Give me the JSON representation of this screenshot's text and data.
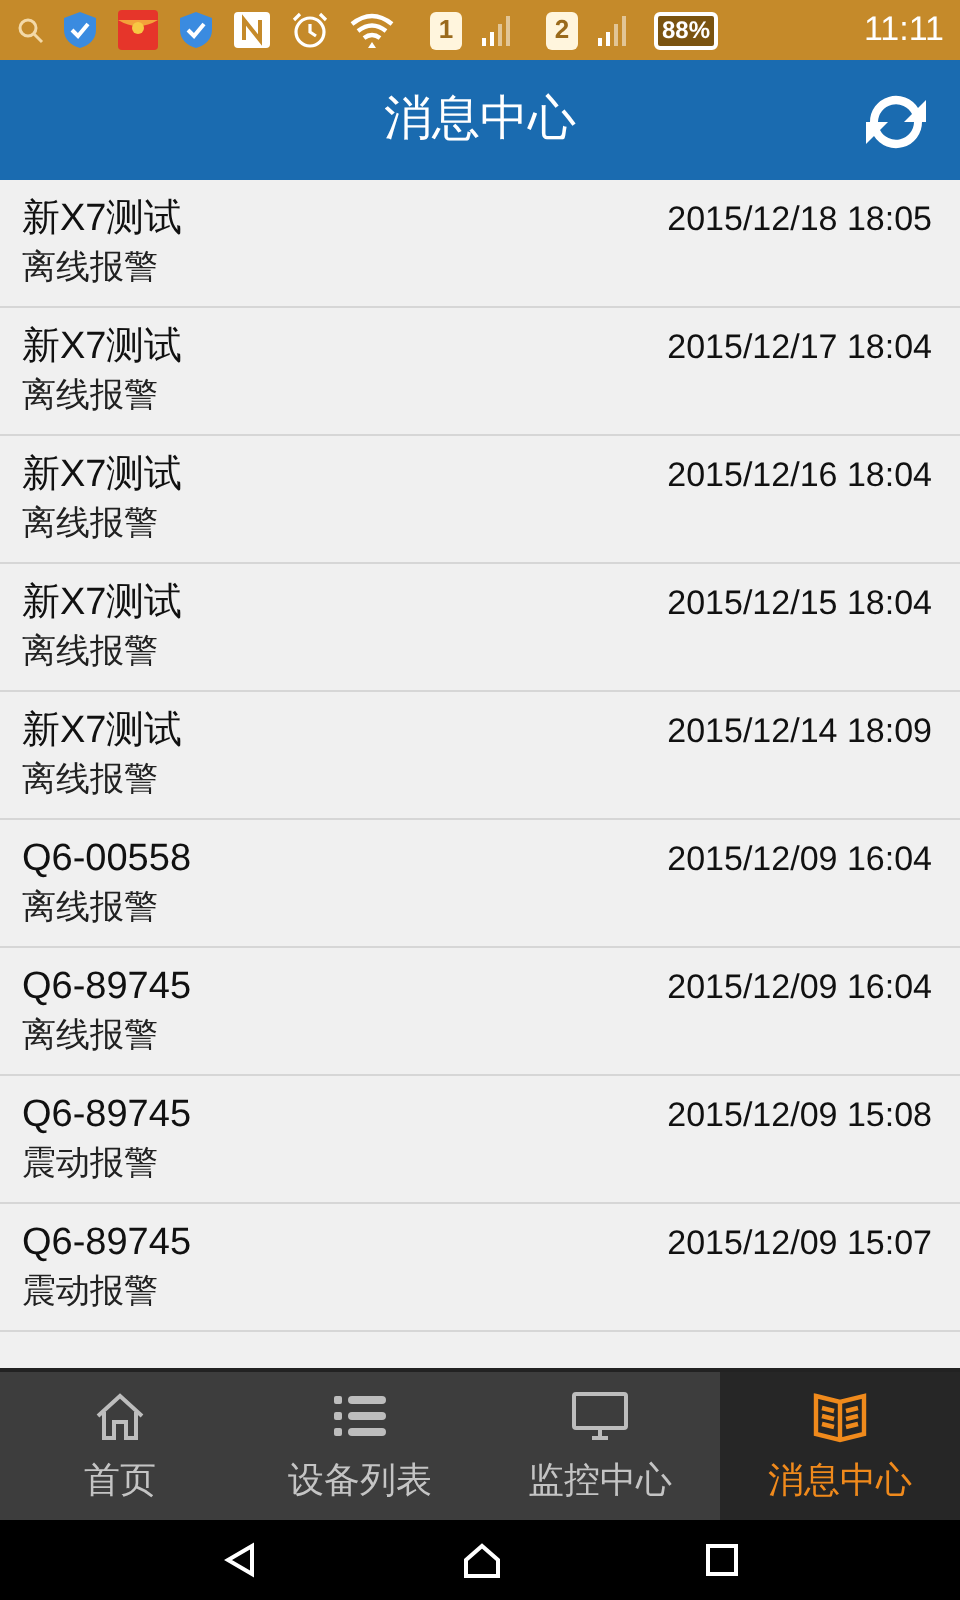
{
  "status_bar": {
    "sim_1": "1",
    "sim_2": "2",
    "battery": "88%",
    "time": "11:11"
  },
  "header": {
    "title": "消息中心"
  },
  "messages": [
    {
      "device": "新X7测试",
      "type": "离线报警",
      "time": "2015/12/18 18:05"
    },
    {
      "device": "新X7测试",
      "type": "离线报警",
      "time": "2015/12/17 18:04"
    },
    {
      "device": "新X7测试",
      "type": "离线报警",
      "time": "2015/12/16 18:04"
    },
    {
      "device": "新X7测试",
      "type": "离线报警",
      "time": "2015/12/15 18:04"
    },
    {
      "device": "新X7测试",
      "type": "离线报警",
      "time": "2015/12/14 18:09"
    },
    {
      "device": "Q6-00558",
      "type": "离线报警",
      "time": "2015/12/09 16:04"
    },
    {
      "device": "Q6-89745",
      "type": "离线报警",
      "time": "2015/12/09 16:04"
    },
    {
      "device": "Q6-89745",
      "type": "震动报警",
      "time": "2015/12/09 15:08"
    },
    {
      "device": "Q6-89745",
      "type": "震动报警",
      "time": "2015/12/09 15:07"
    }
  ],
  "tabs": [
    {
      "label": "首页",
      "selected": false
    },
    {
      "label": "设备列表",
      "selected": false
    },
    {
      "label": "监控中心",
      "selected": false
    },
    {
      "label": "消息中心",
      "selected": true
    }
  ]
}
